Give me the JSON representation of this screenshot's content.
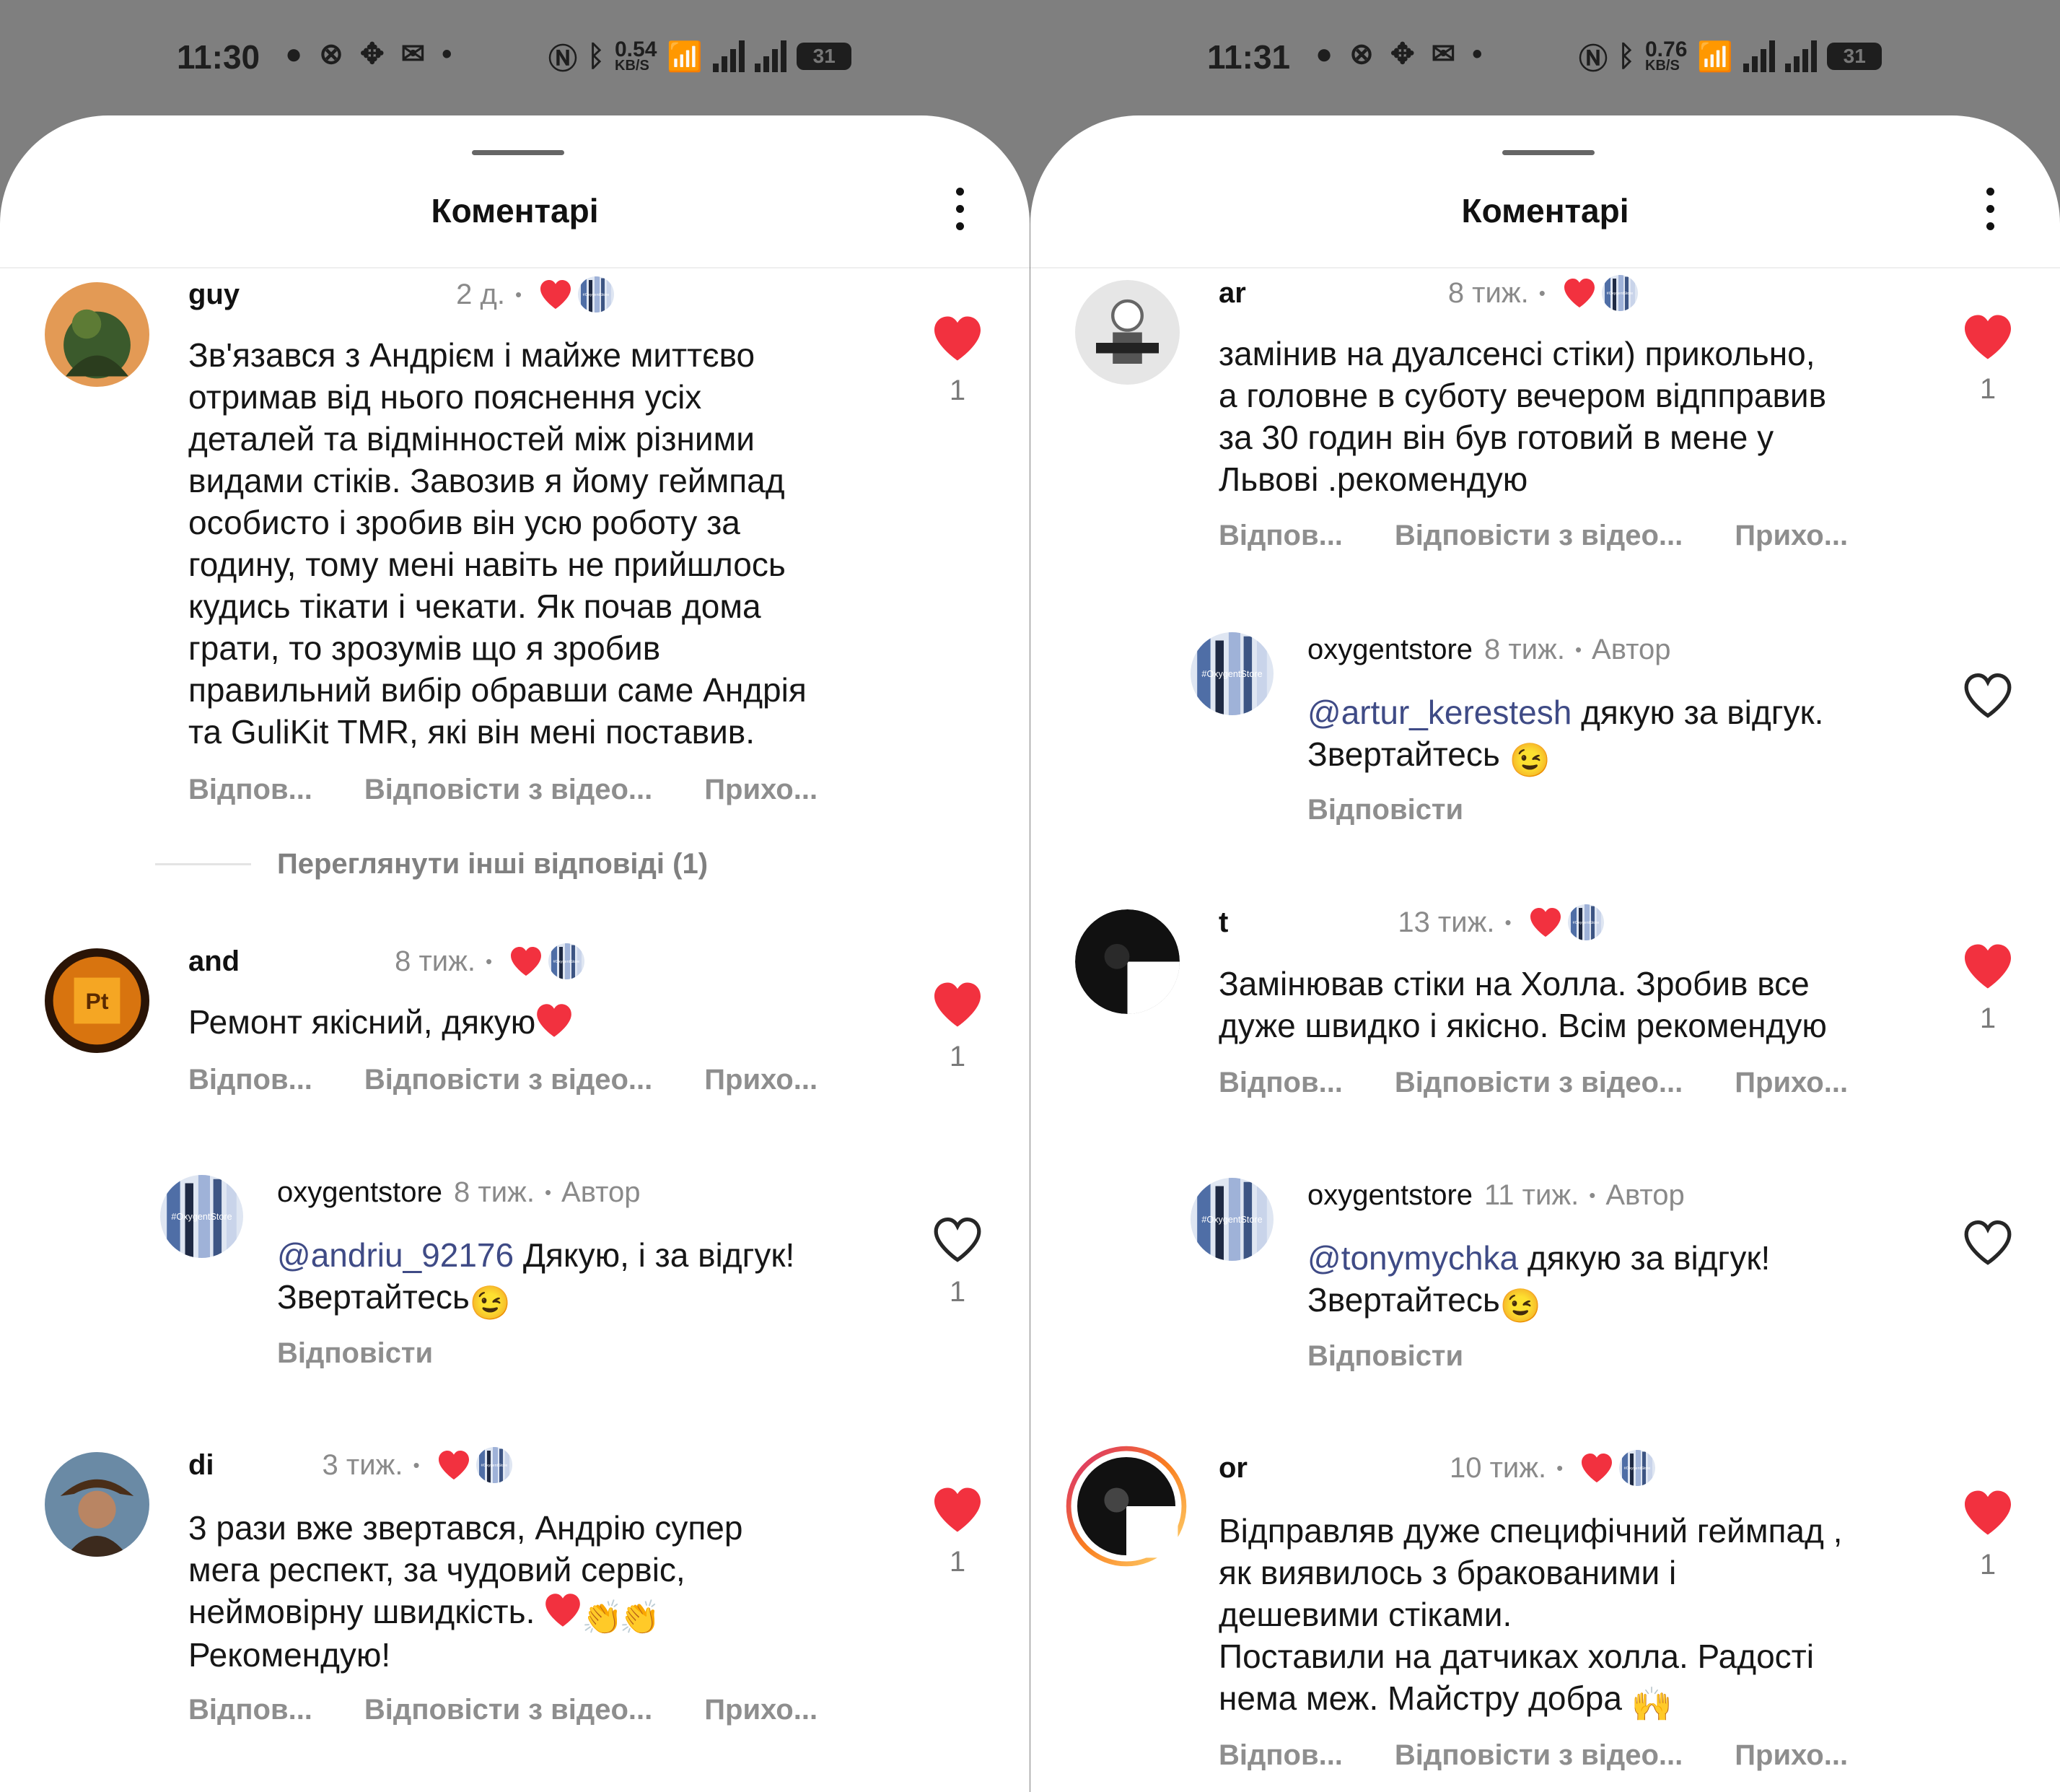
{
  "left": {
    "status": {
      "time": "11:30",
      "speed_value": "0.54",
      "speed_unit": "KB/S",
      "battery": "31"
    },
    "sheet": {
      "title": "Коментарі"
    },
    "comments": [
      {
        "username": "guy",
        "time": "2 д.",
        "text": "Зв'язався з Андрієм і майже миттєво\nотримав від нього пояснення усіх\nдеталей та відмінностей між різними\nвидами стіків. Завозив я йому геймпад\nособисто і зробив він усю роботу за\nгодину, тому мені навіть не прийшлось\nкудись тікати і чекати. Як почав дома\nграти, то зрозумів що я зробив\nправильний вибір обравши саме Андрія\nта GuliKit TMR, які він мені поставив.",
        "likes": "1",
        "actions": [
          "Відпов...",
          "Відповісти з відео...",
          "Прихо..."
        ]
      },
      {
        "username": "and",
        "time": "8 тиж.",
        "text": "Ремонт якісний, дякую",
        "likes": "1",
        "actions": [
          "Відпов...",
          "Відповісти з відео...",
          "Прихо..."
        ]
      },
      {
        "username": "oxygentstore",
        "time": "8 тиж.",
        "author": "Автор",
        "mention": "@andriu_92176",
        "text_after": " Дякую, і за відгук!\nЗвертайтесь",
        "likes": "1",
        "action": "Відповісти"
      },
      {
        "username": "di",
        "time": "3 тиж.",
        "text": "3 рази вже звертався, Андрію супер\nмега респект, за чудовий сервіс,\nнеймовірну швидкість. ",
        "text_end": "\nРекомендую!",
        "likes": "1",
        "actions": [
          "Відпов...",
          "Відповісти з відео...",
          "Прихо..."
        ]
      }
    ],
    "more_replies": "Переглянути інші відповіді (1)"
  },
  "right": {
    "status": {
      "time": "11:31",
      "speed_value": "0.76",
      "speed_unit": "KB/S",
      "battery": "31"
    },
    "sheet": {
      "title": "Коментарі"
    },
    "comments": [
      {
        "username": "ar",
        "time": "8 тиж.",
        "text": "замінив на дуалсенсі стіки) прикольно,\nа головне в суботу вечером відпправив\nза 30 годин він був готовий в мене у\nЛьвові .рекомендую",
        "likes": "1",
        "actions": [
          "Відпов...",
          "Відповісти з відео...",
          "Прихо..."
        ]
      },
      {
        "username": "oxygentstore",
        "time": "8 тиж.",
        "author": "Автор",
        "mention": "@artur_kerestesh",
        "text_after": " дякую за відгук.\nЗвертайтесь ",
        "action": "Відповісти"
      },
      {
        "username": "t",
        "time": "13 тиж.",
        "text": "Замінював стіки на Холла. Зробив все\nдуже швидко і якісно. Всім рекомендую",
        "likes": "1",
        "actions": [
          "Відпов...",
          "Відповісти з відео...",
          "Прихо..."
        ]
      },
      {
        "username": "oxygentstore",
        "time": "11 тиж.",
        "author": "Автор",
        "mention": "@tonymychka",
        "text_after": " дякую за відгук!\nЗвертайтесь",
        "action": "Відповісти"
      },
      {
        "username": "or",
        "time": "10 тиж.",
        "text": "Відправляв дуже специфічний геймпад ,\nяк виявилось з бракованими і\nдешевими стіками.\nПоставили на датчиках холла. Радості\nнема меж. Майстру добра ",
        "likes": "1",
        "actions": [
          "Відпов...",
          "Відповісти з відео...",
          "Прихо..."
        ]
      }
    ]
  },
  "colors": {
    "heart": "#f2313f",
    "mention": "#3f4b86",
    "muted": "#8e8e8e"
  },
  "icons": [
    "chat-icon",
    "app-icon",
    "move-icon",
    "mail-icon",
    "nfc-icon",
    "bluetooth-icon",
    "wifi-icon",
    "signal-icon",
    "battery-icon",
    "heart-icon",
    "heart-outline-icon",
    "more-options-icon"
  ]
}
